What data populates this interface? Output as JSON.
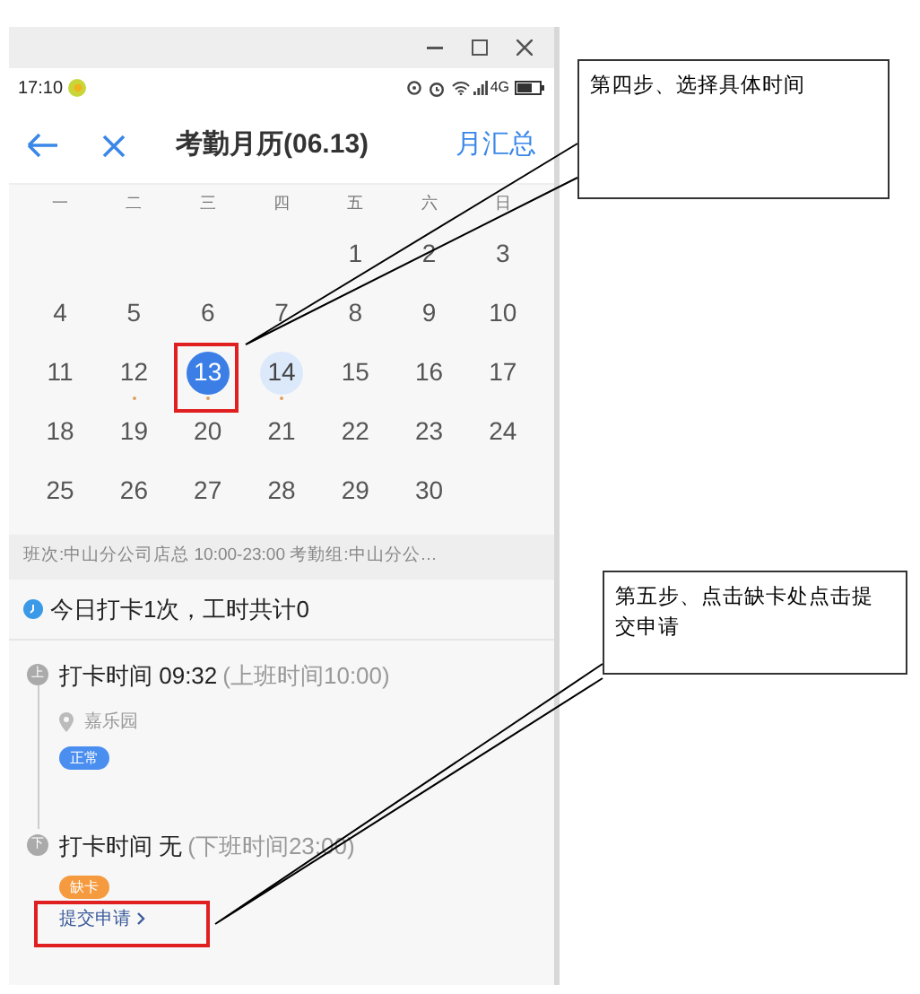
{
  "status_bar": {
    "time": "17:10",
    "network": "4G"
  },
  "nav": {
    "title": "考勤月历(06.13)",
    "action": "月汇总"
  },
  "calendar": {
    "weekdays": [
      "一",
      "二",
      "三",
      "四",
      "五",
      "六",
      "日"
    ],
    "weeks": [
      {
        "days": [
          {
            "label": "1",
            "selected": false,
            "today": false,
            "marked": false
          },
          {
            "label": "2",
            "selected": false,
            "today": false,
            "marked": false
          },
          {
            "label": "3",
            "selected": false,
            "today": false,
            "marked": false
          }
        ]
      },
      {
        "days": [
          {
            "label": "4",
            "selected": false,
            "today": false,
            "marked": false
          },
          {
            "label": "5",
            "selected": false,
            "today": false,
            "marked": false
          },
          {
            "label": "6",
            "selected": false,
            "today": false,
            "marked": false
          },
          {
            "label": "7",
            "selected": false,
            "today": false,
            "marked": false
          },
          {
            "label": "8",
            "selected": false,
            "today": false,
            "marked": false
          },
          {
            "label": "9",
            "selected": false,
            "today": false,
            "marked": false
          },
          {
            "label": "10",
            "selected": false,
            "today": false,
            "marked": false
          }
        ]
      },
      {
        "days": [
          {
            "label": "11",
            "selected": false,
            "today": false,
            "marked": false
          },
          {
            "label": "12",
            "selected": false,
            "today": false,
            "marked": true
          },
          {
            "label": "13",
            "selected": true,
            "today": false,
            "marked": true
          },
          {
            "label": "14",
            "selected": false,
            "today": true,
            "marked": true
          },
          {
            "label": "15",
            "selected": false,
            "today": false,
            "marked": false
          },
          {
            "label": "16",
            "selected": false,
            "today": false,
            "marked": false
          },
          {
            "label": "17",
            "selected": false,
            "today": false,
            "marked": false
          }
        ]
      },
      {
        "days": [
          {
            "label": "18",
            "selected": false,
            "today": false,
            "marked": false
          },
          {
            "label": "19",
            "selected": false,
            "today": false,
            "marked": false
          },
          {
            "label": "20",
            "selected": false,
            "today": false,
            "marked": false
          },
          {
            "label": "21",
            "selected": false,
            "today": false,
            "marked": false
          },
          {
            "label": "22",
            "selected": false,
            "today": false,
            "marked": false
          },
          {
            "label": "23",
            "selected": false,
            "today": false,
            "marked": false
          },
          {
            "label": "24",
            "selected": false,
            "today": false,
            "marked": false
          }
        ]
      },
      {
        "days": [
          {
            "label": "25",
            "selected": false,
            "today": false,
            "marked": false
          },
          {
            "label": "26",
            "selected": false,
            "today": false,
            "marked": false
          },
          {
            "label": "27",
            "selected": false,
            "today": false,
            "marked": false
          },
          {
            "label": "28",
            "selected": false,
            "today": false,
            "marked": false
          },
          {
            "label": "29",
            "selected": false,
            "today": false,
            "marked": false
          },
          {
            "label": "30",
            "selected": false,
            "today": false,
            "marked": false
          }
        ]
      }
    ]
  },
  "shift_info": "班次:中山分公司店总 10:00-23:00 考勤组:中山分公…",
  "summary": "今日打卡1次，工时共计0",
  "records": [
    {
      "icon_label": "上",
      "time": "打卡时间 09:32",
      "expected": "(上班时间10:00)",
      "location": "嘉乐园",
      "status": {
        "label": "正常",
        "color": "#4a8ef0"
      }
    },
    {
      "icon_label": "下",
      "time": "打卡时间 无",
      "expected": "(下班时间23:00)",
      "status": {
        "label": "缺卡",
        "color": "#f59a3e"
      },
      "action": "提交申请"
    }
  ],
  "callouts": [
    {
      "text": "第四步、选择具体时间"
    },
    {
      "text": "第五步、点击缺卡处点击提交申请"
    }
  ]
}
